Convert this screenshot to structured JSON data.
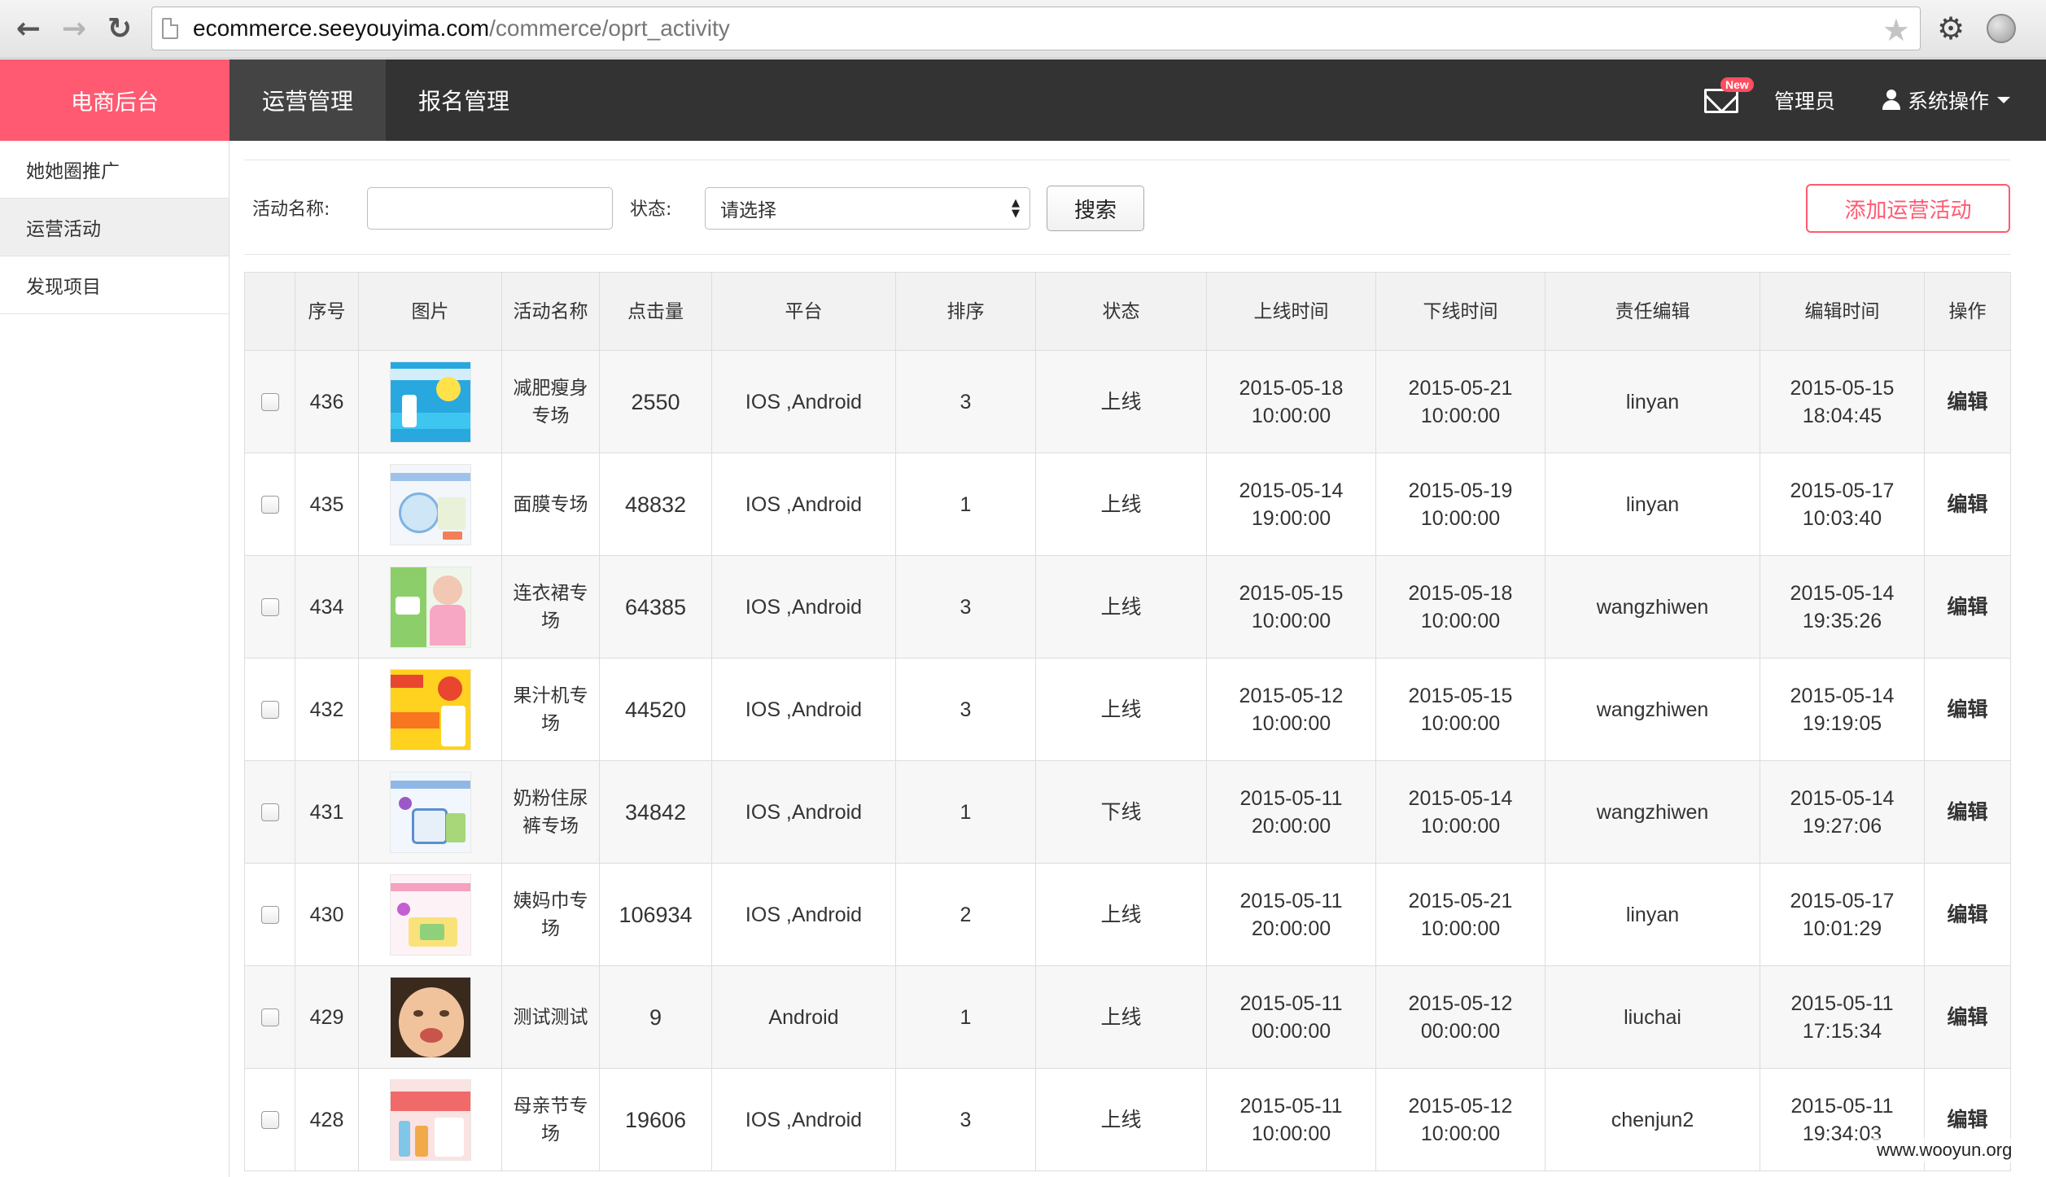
{
  "browser": {
    "url_host": "ecommerce.seeyouyima.com",
    "url_path": "/commerce/oprt_activity"
  },
  "header": {
    "brand": "电商后台",
    "tabs": [
      {
        "label": "运营管理",
        "active": true
      },
      {
        "label": "报名管理",
        "active": false
      }
    ],
    "new_badge": "New",
    "admin": "管理员",
    "system_ops": "系统操作"
  },
  "sidebar": {
    "items": [
      {
        "label": "她她圈推广",
        "active": false
      },
      {
        "label": "运营活动",
        "active": true
      },
      {
        "label": "发现项目",
        "active": false
      }
    ]
  },
  "filters": {
    "name_label": "活动名称:",
    "name_value": "",
    "status_label": "状态:",
    "status_selected": "请选择",
    "search_button": "搜索",
    "add_button": "添加运营活动"
  },
  "table": {
    "columns": [
      "",
      "序号",
      "图片",
      "活动名称",
      "点击量",
      "平台",
      "排序",
      "状态",
      "上线时间",
      "下线时间",
      "责任编辑",
      "编辑时间",
      "操作"
    ],
    "rows": [
      {
        "id": "436",
        "name": "减肥瘦身专场",
        "clicks": "2550",
        "platform": "IOS ,Android",
        "order": "3",
        "status": "上线",
        "online_date": "2015-05-18",
        "online_time": "10:00:00",
        "offline_date": "2015-05-21",
        "offline_time": "10:00:00",
        "editor": "linyan",
        "edit_date": "2015-05-15",
        "edit_time": "18:04:45",
        "action": "编辑"
      },
      {
        "id": "435",
        "name": "面膜专场",
        "clicks": "48832",
        "platform": "IOS ,Android",
        "order": "1",
        "status": "上线",
        "online_date": "2015-05-14",
        "online_time": "19:00:00",
        "offline_date": "2015-05-19",
        "offline_time": "10:00:00",
        "editor": "linyan",
        "edit_date": "2015-05-17",
        "edit_time": "10:03:40",
        "action": "编辑"
      },
      {
        "id": "434",
        "name": "连衣裙专场",
        "clicks": "64385",
        "platform": "IOS ,Android",
        "order": "3",
        "status": "上线",
        "online_date": "2015-05-15",
        "online_time": "10:00:00",
        "offline_date": "2015-05-18",
        "offline_time": "10:00:00",
        "editor": "wangzhiwen",
        "edit_date": "2015-05-14",
        "edit_time": "19:35:26",
        "action": "编辑"
      },
      {
        "id": "432",
        "name": "果汁机专场",
        "clicks": "44520",
        "platform": "IOS ,Android",
        "order": "3",
        "status": "上线",
        "online_date": "2015-05-12",
        "online_time": "10:00:00",
        "offline_date": "2015-05-15",
        "offline_time": "10:00:00",
        "editor": "wangzhiwen",
        "edit_date": "2015-05-14",
        "edit_time": "19:19:05",
        "action": "编辑"
      },
      {
        "id": "431",
        "name": "奶粉住尿裤专场",
        "clicks": "34842",
        "platform": "IOS ,Android",
        "order": "1",
        "status": "下线",
        "online_date": "2015-05-11",
        "online_time": "20:00:00",
        "offline_date": "2015-05-14",
        "offline_time": "10:00:00",
        "editor": "wangzhiwen",
        "edit_date": "2015-05-14",
        "edit_time": "19:27:06",
        "action": "编辑"
      },
      {
        "id": "430",
        "name": "姨妈巾专场",
        "clicks": "106934",
        "platform": "IOS ,Android",
        "order": "2",
        "status": "上线",
        "online_date": "2015-05-11",
        "online_time": "20:00:00",
        "offline_date": "2015-05-21",
        "offline_time": "10:00:00",
        "editor": "linyan",
        "edit_date": "2015-05-17",
        "edit_time": "10:01:29",
        "action": "编辑"
      },
      {
        "id": "429",
        "name": "测试测试",
        "clicks": "9",
        "platform": "Android",
        "order": "1",
        "status": "上线",
        "online_date": "2015-05-11",
        "online_time": "00:00:00",
        "offline_date": "2015-05-12",
        "offline_time": "00:00:00",
        "editor": "liuchai",
        "edit_date": "2015-05-11",
        "edit_time": "17:15:34",
        "action": "编辑"
      },
      {
        "id": "428",
        "name": "母亲节专场",
        "clicks": "19606",
        "platform": "IOS ,Android",
        "order": "3",
        "status": "上线",
        "online_date": "2015-05-11",
        "online_time": "10:00:00",
        "offline_date": "2015-05-12",
        "offline_time": "10:00:00",
        "editor": "chenjun2",
        "edit_date": "2015-05-11",
        "edit_time": "19:34:03",
        "action": "编辑"
      }
    ]
  },
  "watermark": "www.wooyun.org",
  "colors": {
    "brand": "#ff5a72",
    "header": "#333333",
    "active_tab": "#444444",
    "link": "#1a8fd0"
  }
}
